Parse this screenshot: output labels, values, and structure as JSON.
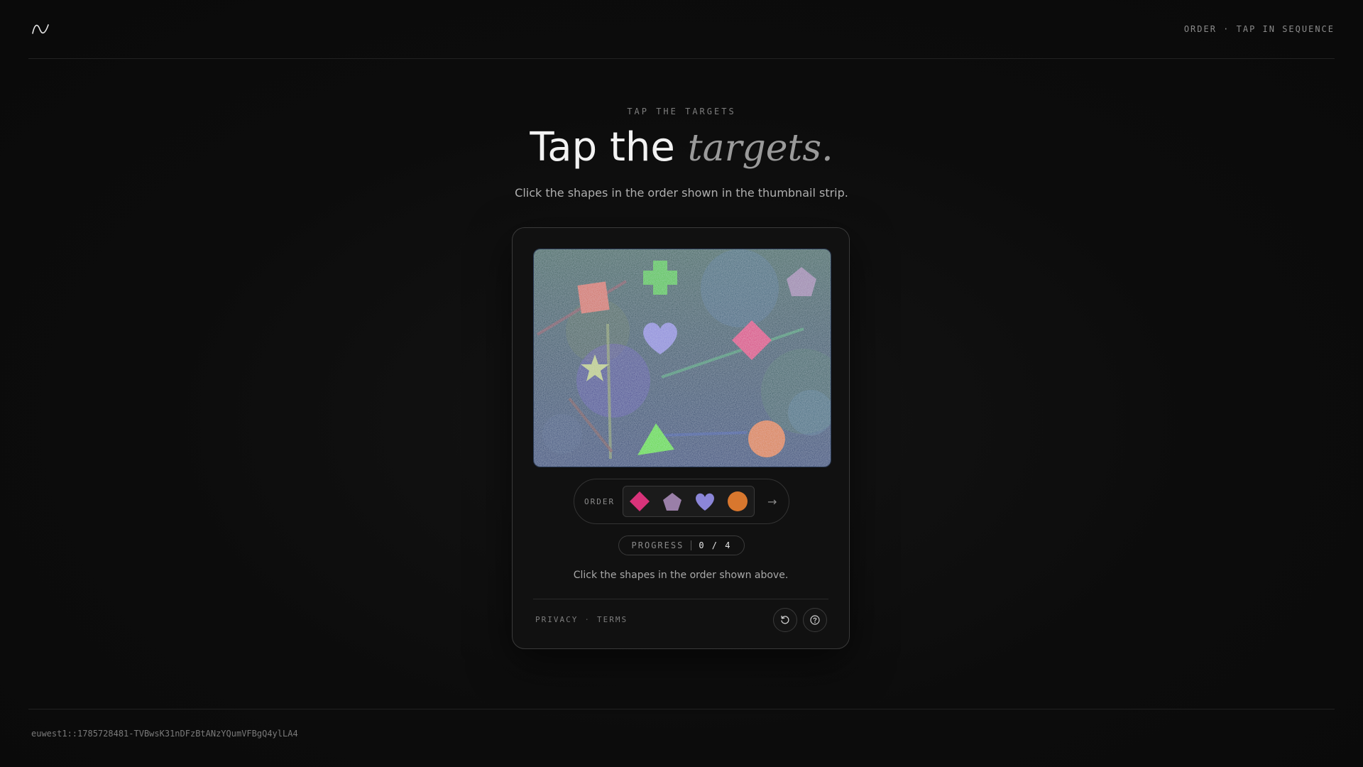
{
  "header": {
    "logo_icon": "wave-logo-icon",
    "mode_text": "ORDER · TAP IN SEQUENCE"
  },
  "hero": {
    "eyebrow": "TAP THE TARGETS",
    "title_plain": "Tap the",
    "title_accent": "targets.",
    "subtitle": "Click the shapes in the order shown in the thumbnail strip."
  },
  "challenge": {
    "canvas_shapes": [
      "square",
      "cross",
      "pentagon",
      "diamond",
      "heart",
      "star",
      "triangle",
      "circle"
    ],
    "order_label": "ORDER",
    "order_sequence": [
      {
        "shape": "diamond",
        "color": "#d8337a"
      },
      {
        "shape": "pentagon",
        "color": "#9a7fa8"
      },
      {
        "shape": "heart",
        "color": "#8b86d8"
      },
      {
        "shape": "circle",
        "color": "#d8772e"
      }
    ],
    "next_icon": "arrow-right-icon",
    "progress_label": "PROGRESS",
    "progress_value": "0 / 4",
    "hint": "Click the shapes in the order shown above.",
    "links": {
      "privacy": "PRIVACY",
      "terms": "TERMS"
    },
    "refresh_icon": "refresh-icon",
    "help_icon": "help-icon"
  },
  "footer": {
    "session_id": "euwest1::1785728481-TVBwsK31nDFzBtANzYQumVFBgQ4ylLA4"
  }
}
